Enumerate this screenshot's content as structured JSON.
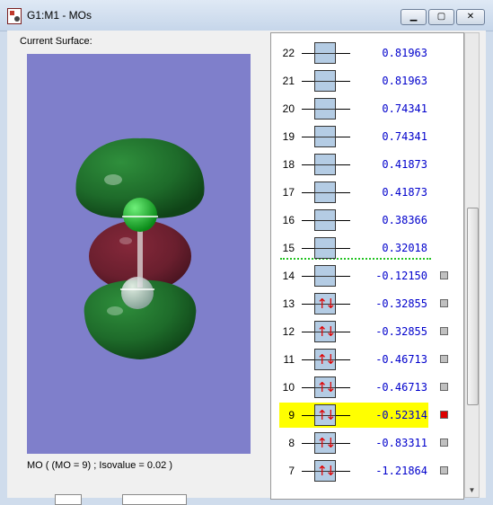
{
  "window": {
    "title": "G1:M1 - MOs",
    "minimize_label": "▁",
    "maximize_label": "▢",
    "close_label": "✕"
  },
  "surface": {
    "label": "Current Surface:",
    "caption": "MO ( (MO = 9) ; Isovalue = 0.02 )",
    "colors": {
      "background": "#7f7fcb",
      "positive_lobe": "#1e6b2a",
      "negative_lobe": "#6a1f2e"
    }
  },
  "orbitals": [
    {
      "index": "22",
      "energy": "0.81963",
      "occupied": false,
      "selected": false
    },
    {
      "index": "21",
      "energy": "0.81963",
      "occupied": false,
      "selected": false
    },
    {
      "index": "20",
      "energy": "0.74341",
      "occupied": false,
      "selected": false
    },
    {
      "index": "19",
      "energy": "0.74341",
      "occupied": false,
      "selected": false
    },
    {
      "index": "18",
      "energy": "0.41873",
      "occupied": false,
      "selected": false
    },
    {
      "index": "17",
      "energy": "0.41873",
      "occupied": false,
      "selected": false
    },
    {
      "index": "16",
      "energy": "0.38366",
      "occupied": false,
      "selected": false
    },
    {
      "index": "15",
      "energy": "0.32018",
      "occupied": false,
      "selected": false
    },
    {
      "index": "14",
      "energy": "-0.12150",
      "occupied": false,
      "selected": false
    },
    {
      "index": "13",
      "energy": "-0.32855",
      "occupied": true,
      "selected": false
    },
    {
      "index": "12",
      "energy": "-0.32855",
      "occupied": true,
      "selected": false
    },
    {
      "index": "11",
      "energy": "-0.46713",
      "occupied": true,
      "selected": false
    },
    {
      "index": "10",
      "energy": "-0.46713",
      "occupied": true,
      "selected": false
    },
    {
      "index": "9",
      "energy": "-0.52314",
      "occupied": true,
      "selected": true
    },
    {
      "index": "8",
      "energy": "-0.83311",
      "occupied": true,
      "selected": false
    },
    {
      "index": "7",
      "energy": "-1.21864",
      "occupied": true,
      "selected": false
    }
  ],
  "colors": {
    "virtual_energy": "#0000cc",
    "occupied_energy": "#0000cc",
    "selected_highlight": "#ffff00",
    "selected_marker": "#dd0000",
    "homo_lumo_line": "#22c322",
    "electron_arrows": "#e00000"
  }
}
